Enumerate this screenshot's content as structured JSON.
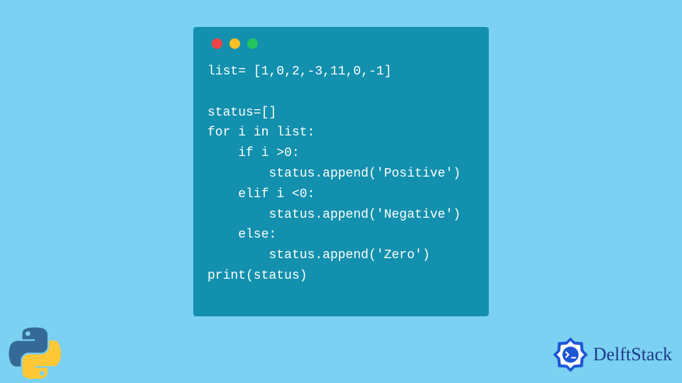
{
  "colors": {
    "page_bg": "#7AD1F2",
    "window_bg": "#1290AD",
    "code_fg": "#FFFFFF",
    "dot_red": "#EF4444",
    "dot_yellow": "#FBBF24",
    "dot_green": "#22C55E",
    "brand_text": "#1E3A8A"
  },
  "code": {
    "lines": [
      "list= [1,0,2,-3,11,0,-1]",
      "",
      "status=[]",
      "for i in list:",
      "    if i >0:",
      "        status.append('Positive')",
      "    elif i <0:",
      "        status.append('Negative')",
      "    else:",
      "        status.append('Zero')",
      "print(status)"
    ]
  },
  "icons": {
    "python": "python-logo",
    "brand_badge": "delftstack-badge"
  },
  "brand": {
    "name": "DelftStack"
  }
}
